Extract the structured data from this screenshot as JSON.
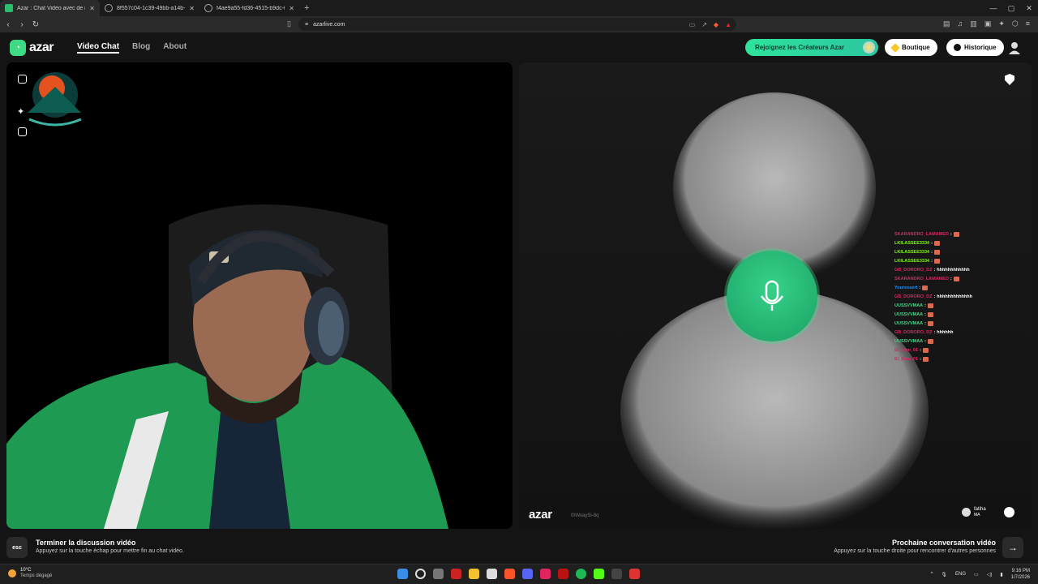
{
  "browser": {
    "tabs": [
      {
        "title": "Azar : Chat Vidéo avec de no",
        "active": true
      },
      {
        "title": "8f557c04-1c39-49bb-a14b-3cadf17",
        "active": false
      },
      {
        "title": "f4ae9a55-fd36-4515-b9dc-0f1f0a65",
        "active": false
      }
    ],
    "url": "azarlive.com"
  },
  "header": {
    "logo_text": "azar",
    "nav": [
      "Video Chat",
      "Blog",
      "About"
    ],
    "cta_label": "Rejoignez les Créateurs Azar",
    "shop_label": "Boutique",
    "history_label": "Historique"
  },
  "remote": {
    "brand": "azar",
    "brand_id": "0hNvaySi-8q",
    "peer_name": "fatiha",
    "peer_country": "MA"
  },
  "chat": [
    {
      "user": "SKARANDRO_LAMAMED",
      "msg": "",
      "color": "#e0245e"
    },
    {
      "user": "LKILASSEE3334",
      "msg": "",
      "color": "#7cfc00"
    },
    {
      "user": "LKILASSEE3334",
      "msg": "",
      "color": "#7cfc00"
    },
    {
      "user": "LKILASSEE3334",
      "msg": "",
      "color": "#7cfc00"
    },
    {
      "user": "GB_DORORO_DZ",
      "msg": "hhhhhhhhhhhh",
      "color": "#e0245e"
    },
    {
      "user": "SKARANDRO_LAMAMED",
      "msg": "",
      "color": "#e0245e"
    },
    {
      "user": "Youressert",
      "msg": "",
      "color": "#1e90ff"
    },
    {
      "user": "GB_DORORO_DZ",
      "msg": "hhhhhhhhhhhhh",
      "color": "#e0245e"
    },
    {
      "user": "UUSSVVMAA",
      "msg": "",
      "color": "#3ddc84"
    },
    {
      "user": "UUSSVVMAA",
      "msg": "",
      "color": "#3ddc84"
    },
    {
      "user": "UUSSVVMAA",
      "msg": "",
      "color": "#3ddc84"
    },
    {
      "user": "GB_DORORO_DZ",
      "msg": "hhhhhh",
      "color": "#e0245e"
    },
    {
      "user": "UUSSVVMAA",
      "msg": "",
      "color": "#3ddc84"
    },
    {
      "user": "El_Sam_01",
      "msg": "",
      "color": "#e0245e"
    },
    {
      "user": "El_Sam_01",
      "msg": "",
      "color": "#e0245e"
    }
  ],
  "footer": {
    "esc_key": "esc",
    "end_title": "Terminer la discussion vidéo",
    "end_sub": "Appuyez sur la touche échap pour mettre fin au chat vidéo.",
    "next_title": "Prochaine conversation vidéo",
    "next_sub": "Appuyez sur la touche droite pour rencontrer d'autres personnes",
    "next_arrow": "→"
  },
  "taskbar": {
    "temp": "10°C",
    "weather": "Temps dégagé",
    "lang": "ENG",
    "time": "9:16 PM",
    "date": "1/7/2026"
  }
}
